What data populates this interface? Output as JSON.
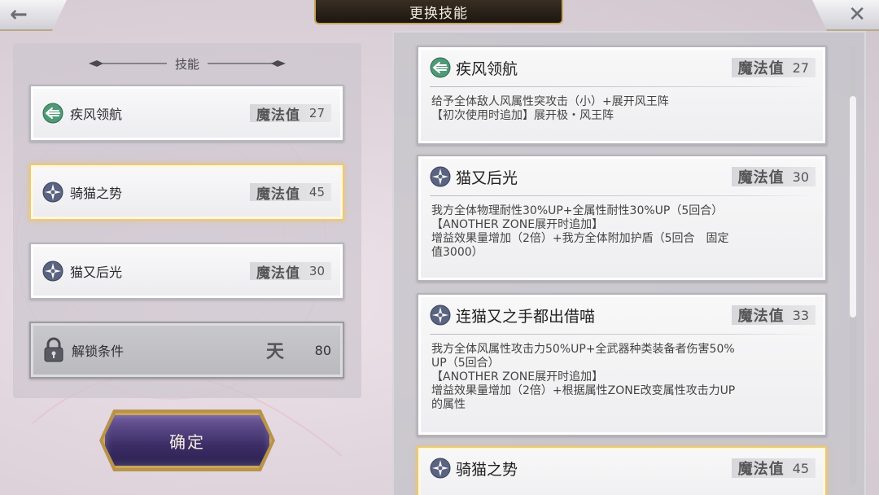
{
  "topbar": {
    "title": "更换技能",
    "back_symbol": "←",
    "close_symbol": "✕"
  },
  "left": {
    "header": "技能",
    "slots": [
      {
        "name": "疾风领航",
        "mp_label": "魔法值",
        "mp": "27",
        "icon": "wind-arrow-icon"
      },
      {
        "name": "骑猫之势",
        "mp_label": "魔法值",
        "mp": "45",
        "icon": "compass-star-icon",
        "selected": true
      },
      {
        "name": "猫又后光",
        "mp_label": "魔法值",
        "mp": "30",
        "icon": "compass-star-icon"
      }
    ],
    "locked": {
      "label": "解锁条件",
      "rank_glyph": "天",
      "value": "80",
      "icon": "lock-icon"
    },
    "confirm_label": "确定"
  },
  "right": {
    "cards": [
      {
        "name": "疾风领航",
        "mp_label": "魔法值",
        "mp": "27",
        "icon": "wind-arrow-icon",
        "desc": [
          "给予全体敌人风属性突攻击（小）+展开风王阵",
          "【初次使用时追加】展开极・风王阵"
        ]
      },
      {
        "name": "猫又后光",
        "mp_label": "魔法值",
        "mp": "30",
        "icon": "compass-star-icon",
        "desc": [
          "我方全体物理耐性30%UP+全属性耐性30%UP（5回合）",
          "【ANOTHER ZONE展开时追加】",
          "增益效果量增加（2倍）+我方全体附加护盾（5回合　固定",
          "值3000）"
        ]
      },
      {
        "name": "连猫又之手都出借喵",
        "mp_label": "魔法值",
        "mp": "33",
        "icon": "compass-star-icon",
        "desc": [
          "我方全体风属性攻击力50%UP+全武器种类装备者伤害50%",
          "UP（5回合）",
          "【ANOTHER ZONE展开时追加】",
          "增益效果量增加（2倍）+根据属性ZONE改变属性攻击力UP",
          "的属性"
        ]
      },
      {
        "name": "骑猫之势",
        "mp_label": "魔法值",
        "mp": "45",
        "icon": "compass-star-icon",
        "desc": []
      }
    ]
  }
}
